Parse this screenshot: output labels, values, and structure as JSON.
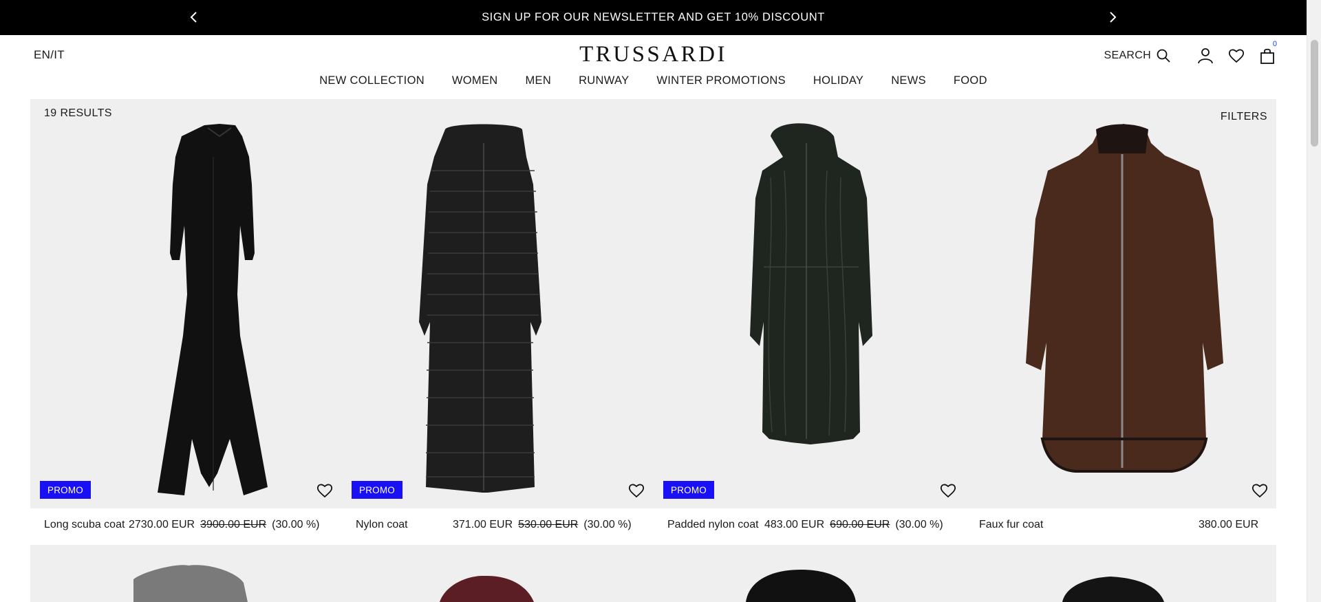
{
  "announcement": {
    "text": "SIGN UP FOR OUR NEWSLETTER AND GET 10% DISCOUNT"
  },
  "header": {
    "language": "EN/IT",
    "logo": "TRUSSARDI",
    "search_label": "SEARCH",
    "cart_count": "0"
  },
  "nav": {
    "items": [
      {
        "label": "NEW COLLECTION"
      },
      {
        "label": "WOMEN"
      },
      {
        "label": "MEN"
      },
      {
        "label": "RUNWAY"
      },
      {
        "label": "WINTER PROMOTIONS"
      },
      {
        "label": "HOLIDAY"
      },
      {
        "label": "NEWS"
      },
      {
        "label": "FOOD"
      }
    ]
  },
  "listing": {
    "results": "19 RESULTS",
    "filters": "FILTERS",
    "products": [
      {
        "name": "Long scuba coat",
        "price": "2730.00 EUR",
        "old_price": "3900.00 EUR",
        "discount": "(30.00 %)",
        "badge": "PROMO",
        "color": "#111111"
      },
      {
        "name": "Nylon coat",
        "price": "371.00 EUR",
        "old_price": "530.00 EUR",
        "discount": "(30.00 %)",
        "badge": "PROMO",
        "color": "#1c1c1c"
      },
      {
        "name": "Padded nylon coat",
        "price": "483.00 EUR",
        "old_price": "690.00 EUR",
        "discount": "(30.00 %)",
        "badge": "PROMO",
        "color": "#1e241f"
      },
      {
        "name": "Faux fur coat",
        "price": "380.00 EUR",
        "old_price": "",
        "discount": "",
        "badge": "",
        "color": "#4a2a1c"
      }
    ]
  },
  "colors": {
    "accent": "#1a10f5",
    "announce_bg": "#000000",
    "grid_bg": "#efefef"
  },
  "icons": [
    "chevron-left-icon",
    "chevron-right-icon",
    "search-icon",
    "user-icon",
    "heart-icon",
    "bag-icon"
  ]
}
